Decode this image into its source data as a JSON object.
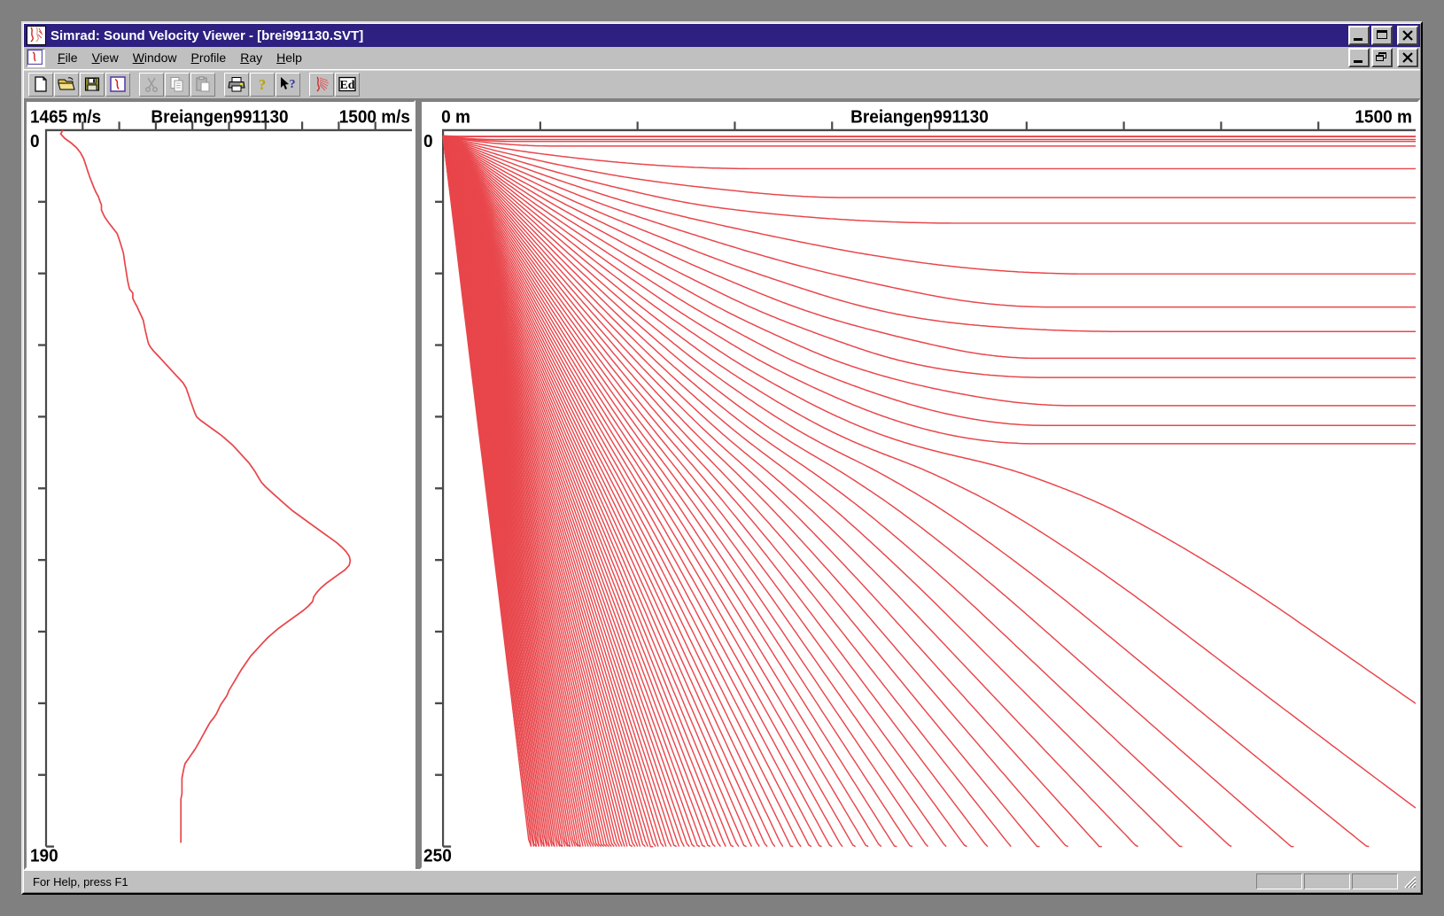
{
  "window": {
    "title": "Simrad: Sound Velocity Viewer - [brei991130.SVT]",
    "icon": "svp-curve-icon",
    "controls": {
      "minimize": "_",
      "maximize": "□",
      "close": "✕",
      "restore": "❐"
    }
  },
  "menubar": {
    "child_icon": "svp-document-icon",
    "items": [
      {
        "label": "File",
        "accel": "F"
      },
      {
        "label": "View",
        "accel": "V"
      },
      {
        "label": "Window",
        "accel": "W"
      },
      {
        "label": "Profile",
        "accel": "P"
      },
      {
        "label": "Ray",
        "accel": "R"
      },
      {
        "label": "Help",
        "accel": "H"
      }
    ]
  },
  "toolbar": {
    "buttons": [
      {
        "name": "new-icon",
        "label": "New",
        "enabled": true
      },
      {
        "name": "open-folder-icon",
        "label": "Open",
        "enabled": true
      },
      {
        "name": "save-disk-icon",
        "label": "Save",
        "enabled": true
      },
      {
        "name": "profile-view-icon",
        "label": "Profile",
        "enabled": true
      },
      {
        "name": "cut-scissors-icon",
        "label": "Cut",
        "enabled": false
      },
      {
        "name": "copy-icon",
        "label": "Copy",
        "enabled": false
      },
      {
        "name": "paste-clipboard-icon",
        "label": "Paste",
        "enabled": false
      },
      {
        "name": "print-icon",
        "label": "Print",
        "enabled": true
      },
      {
        "name": "about-question-icon",
        "label": "About",
        "enabled": true
      },
      {
        "name": "context-help-arrow-icon",
        "label": "Context Help",
        "enabled": true
      },
      {
        "name": "ray-trace-icon",
        "label": "Ray Trace",
        "enabled": true
      },
      {
        "name": "edit-ed-icon",
        "label": "Ed",
        "enabled": true
      }
    ]
  },
  "statusbar": {
    "message": "For Help, press F1",
    "panes": [
      "",
      "",
      ""
    ],
    "grip": "resize-grip-icon"
  },
  "chart_data": [
    {
      "type": "line",
      "name": "sound-velocity-profile",
      "title": "Breiangen991130",
      "xlabel_left": "1465 m/s",
      "xlabel_right": "1500 m/s",
      "ylabel_top": "0",
      "ylabel_bottom": "190",
      "xlim": [
        1465,
        1500
      ],
      "ylim": [
        0,
        190
      ],
      "x_ticks": 10,
      "y_ticks": 10,
      "grid": false,
      "line_color": "#e8464b",
      "series": [
        {
          "name": "sound velocity",
          "points": [
            [
              1466.6,
              0.0
            ],
            [
              1466.4,
              1.0
            ],
            [
              1466.8,
              2.2
            ],
            [
              1467.4,
              3.4
            ],
            [
              1467.9,
              4.6
            ],
            [
              1468.3,
              6.0
            ],
            [
              1468.6,
              7.6
            ],
            [
              1468.8,
              9.2
            ],
            [
              1469.0,
              11.0
            ],
            [
              1469.2,
              12.6
            ],
            [
              1469.4,
              14.0
            ],
            [
              1469.6,
              15.4
            ],
            [
              1469.8,
              16.6
            ],
            [
              1470.0,
              17.6
            ],
            [
              1470.1,
              18.4
            ],
            [
              1470.2,
              19.2
            ],
            [
              1470.3,
              19.8
            ],
            [
              1470.3,
              21.2
            ],
            [
              1470.6,
              23.0
            ],
            [
              1471.0,
              24.6
            ],
            [
              1471.4,
              26.0
            ],
            [
              1471.8,
              27.4
            ],
            [
              1472.0,
              29.0
            ],
            [
              1472.2,
              30.8
            ],
            [
              1472.4,
              32.6
            ],
            [
              1472.5,
              34.6
            ],
            [
              1472.6,
              36.4
            ],
            [
              1472.7,
              38.2
            ],
            [
              1472.8,
              39.8
            ],
            [
              1472.9,
              41.2
            ],
            [
              1473.0,
              42.2
            ],
            [
              1473.3,
              43.2
            ],
            [
              1473.3,
              44.6
            ],
            [
              1473.5,
              45.8
            ],
            [
              1473.7,
              46.8
            ],
            [
              1473.9,
              48.0
            ],
            [
              1474.1,
              49.2
            ],
            [
              1474.3,
              50.4
            ],
            [
              1474.4,
              51.8
            ],
            [
              1474.5,
              53.2
            ],
            [
              1474.6,
              54.4
            ],
            [
              1474.7,
              55.6
            ],
            [
              1474.8,
              56.6
            ],
            [
              1475.0,
              57.6
            ],
            [
              1475.3,
              58.6
            ],
            [
              1475.7,
              59.8
            ],
            [
              1476.1,
              61.0
            ],
            [
              1476.5,
              62.2
            ],
            [
              1476.9,
              63.4
            ],
            [
              1477.3,
              64.6
            ],
            [
              1477.7,
              65.8
            ],
            [
              1478.1,
              67.0
            ],
            [
              1478.4,
              68.4
            ],
            [
              1478.6,
              70.0
            ],
            [
              1478.8,
              71.6
            ],
            [
              1479.0,
              73.2
            ],
            [
              1479.2,
              74.8
            ],
            [
              1479.4,
              76.0
            ],
            [
              1479.8,
              77.0
            ],
            [
              1480.3,
              78.0
            ],
            [
              1480.8,
              79.0
            ],
            [
              1481.3,
              80.0
            ],
            [
              1481.8,
              81.0
            ],
            [
              1482.3,
              82.2
            ],
            [
              1482.8,
              83.4
            ],
            [
              1483.2,
              84.6
            ],
            [
              1483.6,
              85.8
            ],
            [
              1484.0,
              87.0
            ],
            [
              1484.4,
              88.2
            ],
            [
              1484.7,
              89.4
            ],
            [
              1485.0,
              90.6
            ],
            [
              1485.3,
              92.0
            ],
            [
              1485.6,
              93.4
            ],
            [
              1486.0,
              94.6
            ],
            [
              1486.4,
              95.6
            ],
            [
              1486.8,
              96.6
            ],
            [
              1487.2,
              97.6
            ],
            [
              1487.6,
              98.6
            ],
            [
              1488.1,
              99.8
            ],
            [
              1488.6,
              101.0
            ],
            [
              1489.2,
              102.2
            ],
            [
              1489.8,
              103.4
            ],
            [
              1490.4,
              104.6
            ],
            [
              1491.0,
              105.8
            ],
            [
              1491.6,
              107.0
            ],
            [
              1492.2,
              108.2
            ],
            [
              1492.8,
              109.4
            ],
            [
              1493.3,
              110.6
            ],
            [
              1493.7,
              111.8
            ],
            [
              1494.0,
              113.0
            ],
            [
              1494.1,
              114.2
            ],
            [
              1494.0,
              115.4
            ],
            [
              1493.6,
              116.6
            ],
            [
              1493.0,
              117.8
            ],
            [
              1492.4,
              119.0
            ],
            [
              1491.8,
              120.2
            ],
            [
              1491.3,
              121.4
            ],
            [
              1490.9,
              122.6
            ],
            [
              1490.6,
              123.8
            ],
            [
              1490.5,
              125.0
            ],
            [
              1490.1,
              126.2
            ],
            [
              1489.6,
              127.4
            ],
            [
              1489.0,
              128.6
            ],
            [
              1488.4,
              129.8
            ],
            [
              1487.8,
              131.0
            ],
            [
              1487.2,
              132.2
            ],
            [
              1486.7,
              133.4
            ],
            [
              1486.2,
              134.6
            ],
            [
              1485.8,
              135.8
            ],
            [
              1485.4,
              137.0
            ],
            [
              1485.0,
              138.2
            ],
            [
              1484.6,
              139.4
            ],
            [
              1484.3,
              140.6
            ],
            [
              1484.0,
              141.8
            ],
            [
              1483.7,
              143.0
            ],
            [
              1483.4,
              144.4
            ],
            [
              1483.1,
              145.8
            ],
            [
              1482.8,
              147.2
            ],
            [
              1482.5,
              148.6
            ],
            [
              1482.3,
              150.0
            ],
            [
              1482.0,
              151.2
            ],
            [
              1481.7,
              152.4
            ],
            [
              1481.5,
              153.6
            ],
            [
              1481.3,
              154.8
            ],
            [
              1481.0,
              156.0
            ],
            [
              1480.7,
              157.0
            ],
            [
              1480.5,
              158.0
            ],
            [
              1480.3,
              159.0
            ],
            [
              1480.1,
              160.0
            ],
            [
              1479.9,
              161.0
            ],
            [
              1479.7,
              162.0
            ],
            [
              1479.5,
              163.0
            ],
            [
              1479.3,
              164.0
            ],
            [
              1479.1,
              164.8
            ],
            [
              1478.9,
              165.6
            ],
            [
              1478.7,
              166.4
            ],
            [
              1478.5,
              167.2
            ],
            [
              1478.3,
              168.0
            ],
            [
              1478.2,
              169.0
            ],
            [
              1478.1,
              170.4
            ],
            [
              1478.0,
              171.8
            ],
            [
              1478.0,
              173.2
            ],
            [
              1478.0,
              174.6
            ],
            [
              1478.0,
              176.0
            ],
            [
              1477.9,
              177.4
            ],
            [
              1477.9,
              178.8
            ],
            [
              1477.9,
              180.2
            ],
            [
              1477.9,
              181.6
            ],
            [
              1477.9,
              183.0
            ],
            [
              1477.9,
              184.4
            ],
            [
              1477.9,
              185.8
            ],
            [
              1477.9,
              187.0
            ],
            [
              1477.9,
              188.0
            ],
            [
              1477.9,
              189.0
            ]
          ]
        }
      ]
    },
    {
      "type": "line",
      "name": "ray-trace-diagram",
      "title": "Breiangen991130",
      "xlabel_left": "0 m",
      "xlabel_right": "1500 m",
      "ylabel_top": "0",
      "ylabel_bottom": "250",
      "xlim": [
        0,
        1500
      ],
      "ylim": [
        0,
        250
      ],
      "x_ticks": 10,
      "y_ticks": 10,
      "grid": false,
      "line_color": "#e8464b",
      "source": {
        "range_m": 0,
        "depth_m": 2
      },
      "ray_count": 120,
      "launch_angle_range_deg": [
        -2,
        62
      ],
      "description": "Fan of acoustic ray paths launched from a point source at the surface, refracting through the sound velocity profile; shallow rays turn upward near 900-1400 m range while steep rays continue downward to 250 m."
    }
  ]
}
